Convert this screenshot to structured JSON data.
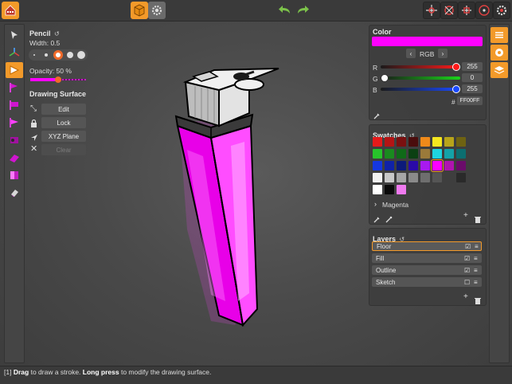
{
  "pencil": {
    "title": "Pencil",
    "width_label": "Width: 0.5",
    "opacity_label": "Opacity: 50 %",
    "opacity_level": 0.5,
    "surface_title": "Drawing Surface",
    "edit_label": "Edit",
    "lock_label": "Lock",
    "plane_label": "XYZ Plane",
    "clear_label": "Clear"
  },
  "color": {
    "title": "Color",
    "current_hex": "#FF00FF",
    "mode": "RGB",
    "r_label": "R",
    "r_value": "255",
    "r_level": 1.0,
    "g_label": "G",
    "g_value": "0",
    "g_level": 0.0,
    "b_label": "B",
    "b_value": "255",
    "b_level": 1.0,
    "hash_label": "#",
    "hex_value": "FF00FF"
  },
  "swatches": {
    "title": "Swatches",
    "group_label": "Magenta",
    "colors": [
      "#e51a1a",
      "#b31414",
      "#7a1010",
      "#4a0d0d",
      "#ef8a1a",
      "#f5e71f",
      "#b8a41a",
      "#6e6212",
      "#27c42b",
      "#1a8a1f",
      "#0f6a18",
      "#0b4012",
      "#9a7a3a",
      "#1ed5e0",
      "#14a3a8",
      "#0c6e70",
      "#1537e0",
      "#1022a8",
      "#0c1a7a",
      "#2a0aa8",
      "#a81af0",
      "#ff00ff",
      "#b014b0",
      "#6a0c6a",
      "#f2f2f2",
      "#c8c8c8",
      "#a6a6a6",
      "#8a8a8a",
      "#6e6e6e",
      "#555555",
      "#3e3e3e",
      "#2a2a2a",
      "#ffffff",
      "#0a0a0a",
      "#f07af0"
    ]
  },
  "layers": {
    "title": "Layers",
    "items": [
      {
        "name": "Floor",
        "visible": true
      },
      {
        "name": "Fill",
        "visible": true
      },
      {
        "name": "Outline",
        "visible": true
      },
      {
        "name": "Sketch",
        "visible": false
      }
    ]
  },
  "status": {
    "step": "[1]",
    "action1": "Drag",
    "text1": "to draw a stroke.",
    "action2": "Long press",
    "text2": "to modify the drawing surface."
  },
  "accent_color": "#f39a2a"
}
